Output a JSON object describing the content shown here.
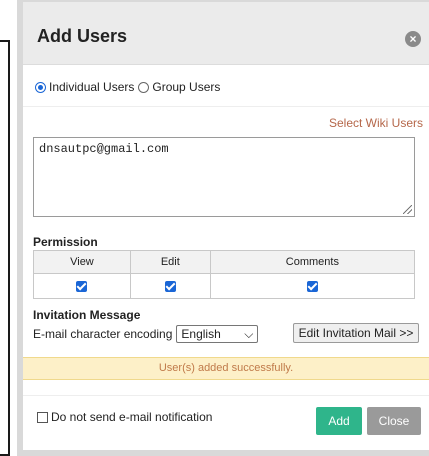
{
  "dialog": {
    "title": "Add Users",
    "close_icon": "close-circle-icon",
    "user_type": {
      "options": [
        "Individual Users",
        "Group Users"
      ],
      "selected": "Individual Users"
    },
    "select_wiki_users_label": "Select Wiki Users",
    "users_text": "dnsautpc@gmail.com",
    "permission": {
      "heading": "Permission",
      "columns": [
        "View",
        "Edit",
        "Comments"
      ],
      "checked": [
        true,
        true,
        true
      ]
    },
    "invitation": {
      "heading": "Invitation Message",
      "encoding_label": "E-mail character encoding",
      "encoding_value": "English",
      "edit_mail_label": "Edit Invitation Mail >>"
    },
    "success_message": "User(s) added successfully.",
    "no_email_label": "Do not send e-mail notification",
    "no_email_checked": false,
    "add_label": "Add",
    "close_label": "Close",
    "colors": {
      "add_button": "#2fb58b",
      "close_button": "#9a9a9a",
      "link": "#b5674a",
      "success_bg": "#fdf0c8",
      "checkbox": "#1a66d6"
    }
  }
}
